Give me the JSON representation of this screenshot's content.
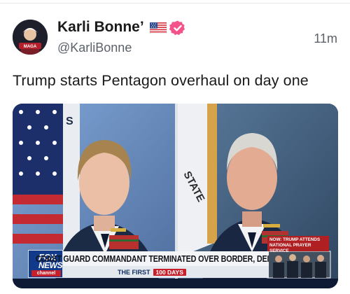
{
  "post": {
    "author": {
      "display_name": "Karli Bonne’",
      "handle": "@KarliBonne",
      "avatar_caption": "MAGA",
      "flag_emoji_icon": "us-flag-icon",
      "verified_icon": "verified-badge-icon",
      "verified_color": "#f4528a"
    },
    "timestamp": "11m",
    "text": "Trump starts Pentagon overhaul on day one"
  },
  "media": {
    "network_logo": {
      "line1": "FOX",
      "line2": "NEWS",
      "line3": "channel"
    },
    "headline": "COAST GUARD COMMANDANT TERMINATED OVER BORDER, DEI",
    "subline": "THE FIRST",
    "subline_badge": "100 DAYS",
    "inset_label": "NOW: TRUMP ATTENDS NATIONAL PRAYER SERVICE",
    "flag_text_left": "S",
    "flag_text_right": "STATE"
  },
  "colors": {
    "text_primary": "#1a1a1a",
    "text_secondary": "#5b6169",
    "fox_blue": "#123a8a",
    "fox_red": "#c8202a"
  }
}
